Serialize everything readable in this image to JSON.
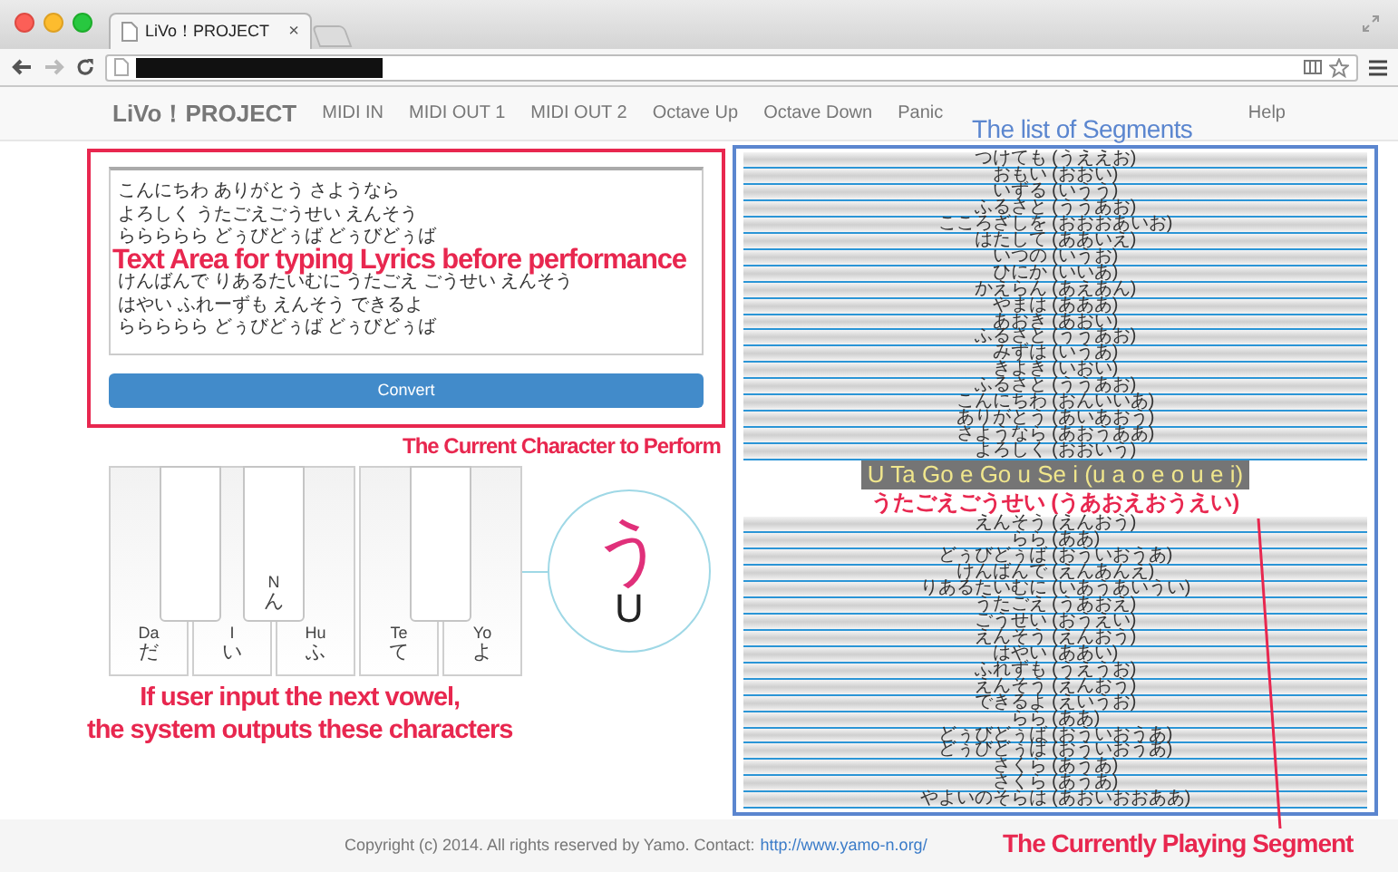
{
  "browser": {
    "tab_title": "LiVo！PROJECT",
    "tab_close": "×"
  },
  "navbar": {
    "brand": "LiVo！PROJECT",
    "items": [
      "MIDI IN",
      "MIDI OUT 1",
      "MIDI OUT 2",
      "Octave Up",
      "Octave Down",
      "Panic"
    ],
    "right_items": [
      "Help"
    ]
  },
  "lyrics": {
    "paragraphs": [
      [
        "こんにちわ ありがとう さようなら",
        "よろしく うたごえごうせい えんそう",
        "ららららら どぅびどぅば どぅびどぅば"
      ],
      [
        "けんばんで りあるたいむに うたごえ ごうせい えんそう",
        "はやい ふれーずも えんそう できるよ",
        "ららららら どぅびどぅば どぅびどぅば"
      ]
    ],
    "button": "Convert"
  },
  "keyboard": {
    "keys": [
      {
        "kind": "white",
        "romaji": "Da",
        "kana": "だ"
      },
      {
        "kind": "black"
      },
      {
        "kind": "white",
        "romaji": "I",
        "kana": "い"
      },
      {
        "kind": "black",
        "romaji": "N",
        "kana": "ん"
      },
      {
        "kind": "white",
        "romaji": "Hu",
        "kana": "ふ"
      },
      {
        "kind": "white",
        "romaji": "Te",
        "kana": "て"
      },
      {
        "kind": "black"
      },
      {
        "kind": "white",
        "romaji": "Yo",
        "kana": "よ"
      }
    ]
  },
  "current_character": {
    "kana": "う",
    "romaji": "U"
  },
  "segments": [
    {
      "text": "つけても (うええお)",
      "selected": false
    },
    {
      "text": "おもい (おおい)",
      "selected": false
    },
    {
      "text": "いずる (いうう)",
      "selected": false
    },
    {
      "text": "ふるさと (ううあお)",
      "selected": false
    },
    {
      "text": "こころざしを (おおおあいお)",
      "selected": false
    },
    {
      "text": "はたして (ああいえ)",
      "selected": false
    },
    {
      "text": "いつの (いうお)",
      "selected": false
    },
    {
      "text": "ひにか (いいあ)",
      "selected": false
    },
    {
      "text": "かえらん (あえあん)",
      "selected": false
    },
    {
      "text": "やまは (あああ)",
      "selected": false
    },
    {
      "text": "あおき (あおい)",
      "selected": false
    },
    {
      "text": "ふるさと (ううあお)",
      "selected": false
    },
    {
      "text": "みずは (いうあ)",
      "selected": false
    },
    {
      "text": "きよき (いおい)",
      "selected": false
    },
    {
      "text": "ふるさと (ううあお)",
      "selected": false
    },
    {
      "text": "こんにちわ (おんいいあ)",
      "selected": false
    },
    {
      "text": "ありがとう (あいあおう)",
      "selected": false
    },
    {
      "text": "さようなら (あおうああ)",
      "selected": false
    },
    {
      "text": "よろしく (おおいう)",
      "selected": false
    },
    {
      "text": "うたごえごうせい (うあおえおうえい)",
      "selected": true,
      "romaji": "U Ta Go e Go u Se i (u a o e o u e i)"
    },
    {
      "text": "えんそう (えんおう)",
      "selected": false
    },
    {
      "text": "らら (ああ)",
      "selected": false
    },
    {
      "text": "どぅびどぅば (おういおうあ)",
      "selected": false
    },
    {
      "text": "けんばんで (えんあんえ)",
      "selected": false
    },
    {
      "text": "りあるたいむに (いあうあいうい)",
      "selected": false
    },
    {
      "text": "うたごえ (うあおえ)",
      "selected": false
    },
    {
      "text": "ごうせい (おうえい)",
      "selected": false
    },
    {
      "text": "えんそう (えんおう)",
      "selected": false
    },
    {
      "text": "はやい (ああい)",
      "selected": false
    },
    {
      "text": "ふれずも (うえうお)",
      "selected": false
    },
    {
      "text": "えんそう (えんおう)",
      "selected": false
    },
    {
      "text": "できるよ (えいうお)",
      "selected": false
    },
    {
      "text": "らら (ああ)",
      "selected": false
    },
    {
      "text": "どぅびどぅば (おういおうあ)",
      "selected": false
    },
    {
      "text": "どぅびどぅば (おういおうあ)",
      "selected": false
    },
    {
      "text": "さくら (あうあ)",
      "selected": false
    },
    {
      "text": "さくら (あうあ)",
      "selected": false
    },
    {
      "text": "やよいのそらは (あおいおおああ)",
      "selected": false
    }
  ],
  "footer": {
    "text": "Copyright (c) 2014. All rights reserved by Yamo. Contact:",
    "link": "http://www.yamo-n.org/"
  },
  "annotations": [
    {
      "kind": "lyrics",
      "text": "Text Area for typing Lyrics before performance"
    },
    {
      "kind": "segments",
      "text": "The list of Segments"
    },
    {
      "kind": "current",
      "text": "The Current Character to Perform"
    },
    {
      "kind": "keys",
      "lines": [
        "If user input the next vowel,",
        "the system outputs these characters"
      ]
    },
    {
      "kind": "playing",
      "text": "The Currently Playing Segment"
    }
  ]
}
